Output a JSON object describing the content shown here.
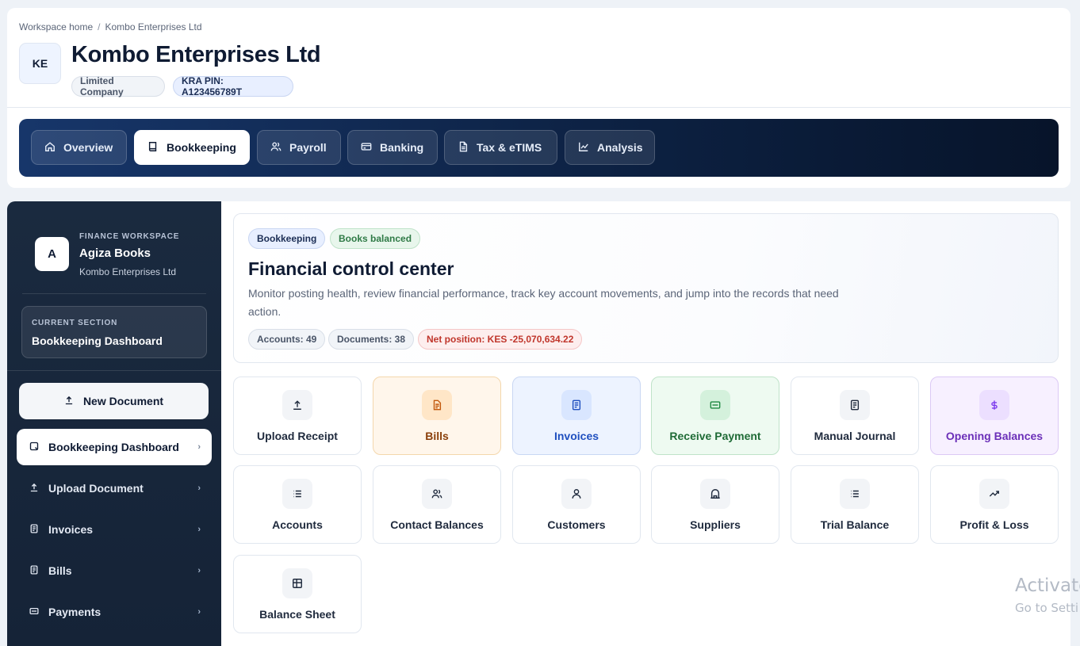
{
  "breadcrumb": {
    "home": "Workspace home",
    "separator": "/",
    "current": "Kombo Enterprises Ltd"
  },
  "company": {
    "initials": "KE",
    "name": "Kombo Enterprises Ltd",
    "type_chip": "Limited Company",
    "kra_chip": "KRA PIN: A123456789T"
  },
  "tabs": [
    {
      "label": "Overview",
      "icon": "home-icon"
    },
    {
      "label": "Bookkeeping",
      "icon": "book-icon",
      "active": true
    },
    {
      "label": "Payroll",
      "icon": "users-icon"
    },
    {
      "label": "Banking",
      "icon": "card-icon"
    },
    {
      "label": "Tax & eTIMS",
      "icon": "document-icon"
    },
    {
      "label": "Analysis",
      "icon": "chart-line-icon"
    }
  ],
  "sidebar": {
    "logo_letter": "A",
    "eyebrow": "FINANCE WORKSPACE",
    "app_name": "Agiza Books",
    "company": "Kombo Enterprises Ltd",
    "current_section_eyebrow": "CURRENT SECTION",
    "current_section": "Bookkeeping Dashboard",
    "new_document": "New Document",
    "chevron": "›",
    "items": [
      {
        "label": "Bookkeeping Dashboard",
        "icon": "dashboard-icon",
        "active": true
      },
      {
        "label": "Upload Document",
        "icon": "upload-icon"
      },
      {
        "label": "Invoices",
        "icon": "invoice-icon"
      },
      {
        "label": "Bills",
        "icon": "bill-icon"
      },
      {
        "label": "Payments",
        "icon": "payment-icon"
      }
    ]
  },
  "hero": {
    "pill_section": "Bookkeeping",
    "pill_status": "Books balanced",
    "title": "Financial control center",
    "description": "Monitor posting health, review financial performance, track key account movements, and jump into the records that need action.",
    "stat_accounts": "Accounts: 49",
    "stat_documents": "Documents: 38",
    "stat_net": "Net position: KES -25,070,634.22"
  },
  "tiles": [
    {
      "label": "Upload Receipt",
      "icon": "upload-icon"
    },
    {
      "label": "Bills",
      "icon": "bill-icon",
      "accent": "#c2570c"
    },
    {
      "label": "Invoices",
      "icon": "invoice-icon",
      "accent": "#1f4fbf"
    },
    {
      "label": "Receive Payment",
      "icon": "payment-icon",
      "accent": "#1f8a43"
    },
    {
      "label": "Manual Journal",
      "icon": "journal-icon"
    },
    {
      "label": "Opening Balances",
      "icon": "currency-icon",
      "accent": "#7c3aed"
    },
    {
      "label": "Accounts",
      "icon": "list-icon"
    },
    {
      "label": "Contact Balances",
      "icon": "contacts-icon"
    },
    {
      "label": "Customers",
      "icon": "user-icon"
    },
    {
      "label": "Suppliers",
      "icon": "supplier-icon"
    },
    {
      "label": "Trial Balance",
      "icon": "list-icon"
    },
    {
      "label": "Profit & Loss",
      "icon": "trend-up-icon"
    },
    {
      "label": "Balance Sheet",
      "icon": "table-icon"
    }
  ],
  "watermark": {
    "line1": "Activate",
    "line2": "Go to Setti"
  }
}
